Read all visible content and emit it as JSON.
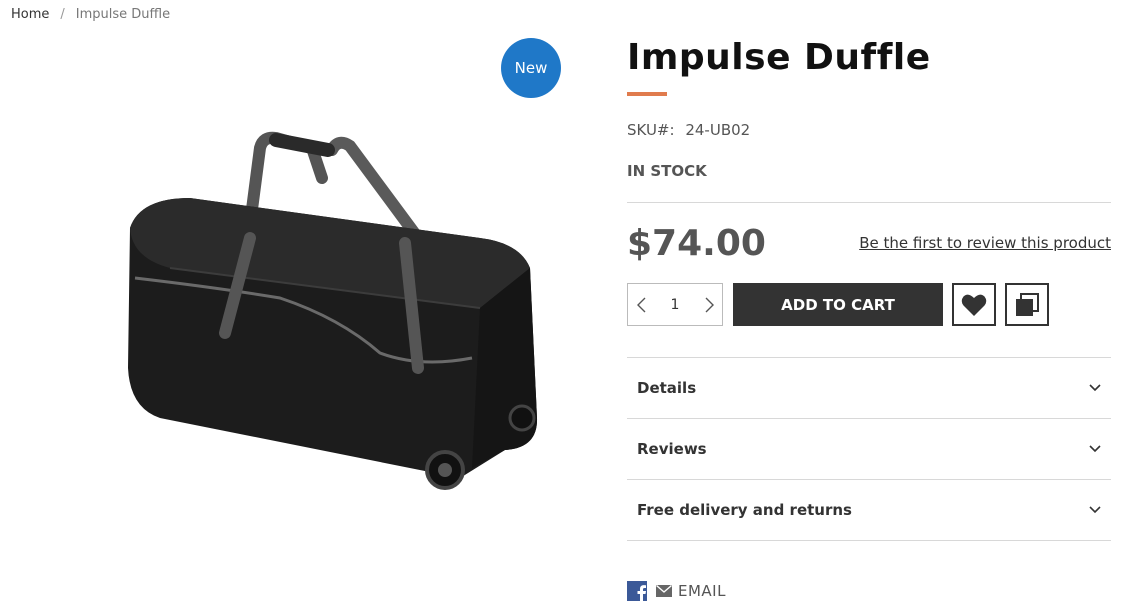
{
  "breadcrumb": {
    "home": "Home",
    "separator": "/",
    "current": "Impulse Duffle"
  },
  "gallery": {
    "badge": "New",
    "badge_color": "#1f78c8"
  },
  "product": {
    "name": "Impulse Duffle",
    "sku_label": "SKU#:",
    "sku": "24-UB02",
    "stock": "IN STOCK",
    "price": "$74.00",
    "review_link": "Be the first to review this product",
    "accent_color": "#e07b4d"
  },
  "cart": {
    "qty": "1",
    "add_label": "ADD TO CART"
  },
  "accordion": [
    {
      "label": "Details"
    },
    {
      "label": "Reviews"
    },
    {
      "label": "Free delivery and returns"
    }
  ],
  "share": {
    "email_label": "EMAIL"
  },
  "icons": [
    "chevron-left-icon",
    "chevron-right-icon",
    "heart-icon",
    "compare-icon",
    "chevron-down-icon",
    "facebook-icon",
    "mail-icon"
  ]
}
